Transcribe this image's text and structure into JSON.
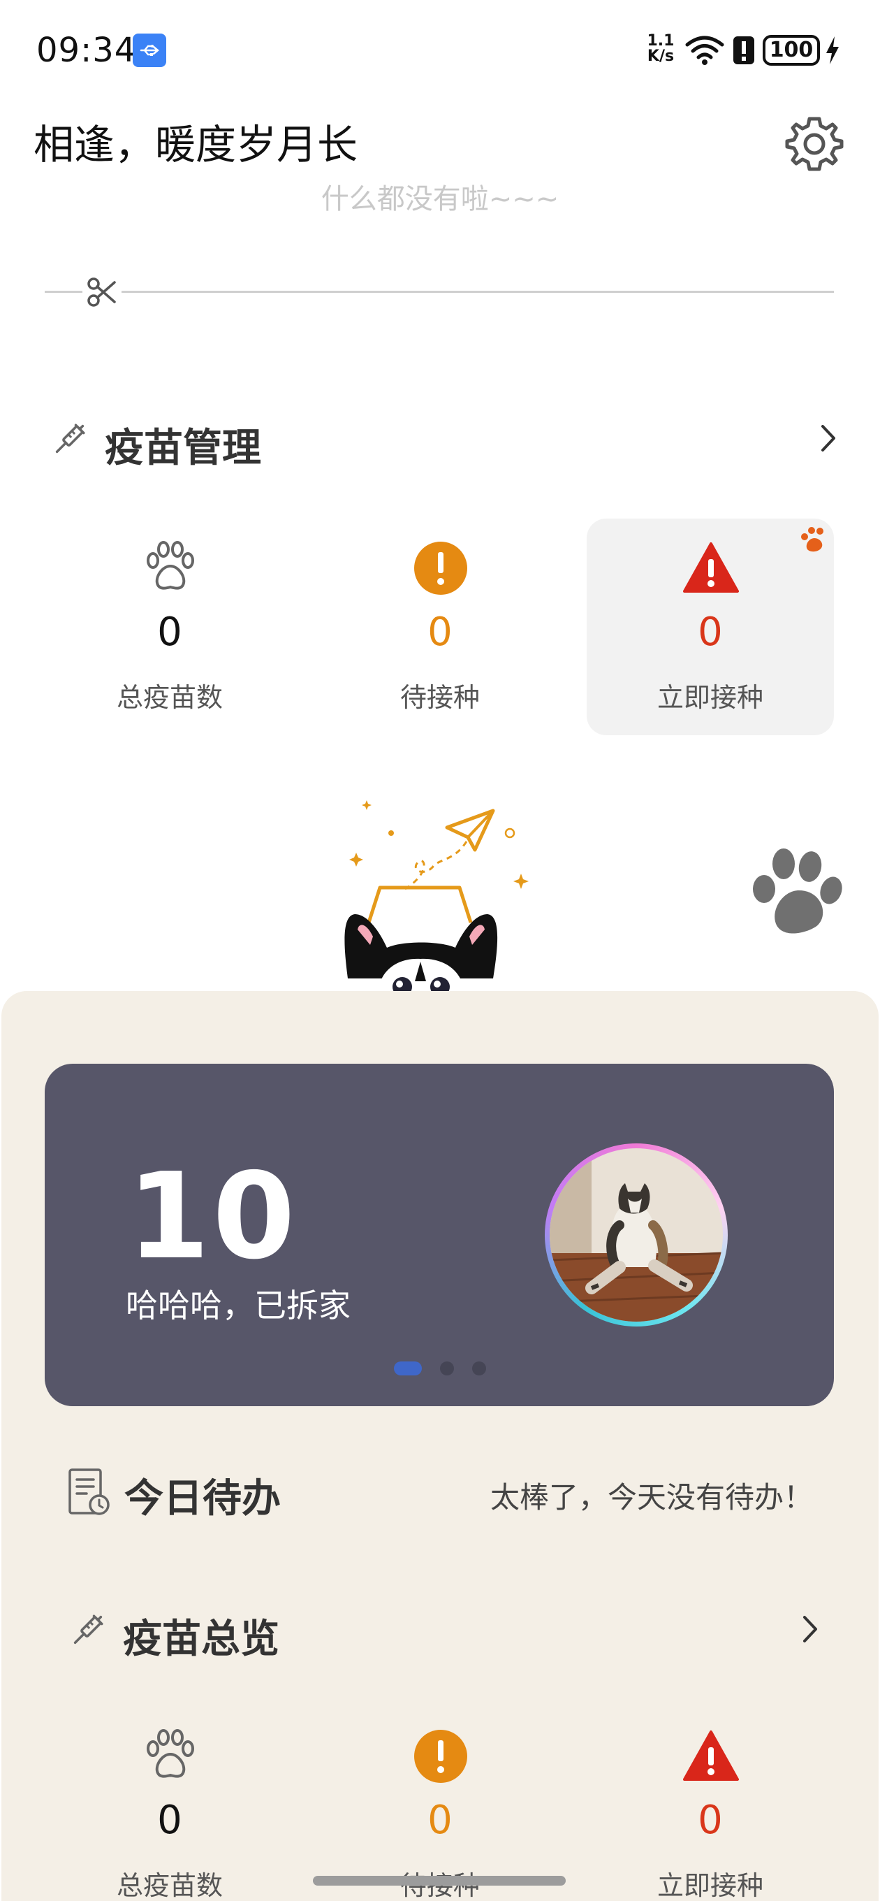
{
  "status_bar": {
    "time": "09:34",
    "net_speed_value": "1.1",
    "net_speed_unit": "K/s",
    "battery": "100",
    "icons": [
      "usb-icon",
      "wifi-icon",
      "alert-icon",
      "battery-icon",
      "charging-icon"
    ]
  },
  "header": {
    "title": "相逢，暖度岁月长",
    "settings_icon": "gear-icon"
  },
  "empty_text": "什么都没有啦~~~",
  "vaccine_management": {
    "title": "疫苗管理",
    "stats": [
      {
        "value": "0",
        "label": "总疫苗数",
        "icon": "paw-icon"
      },
      {
        "value": "0",
        "label": "待接种",
        "icon": "exclamation-circle-icon"
      },
      {
        "value": "0",
        "label": "立即接种",
        "icon": "warning-triangle-icon"
      }
    ]
  },
  "banner": {
    "number": "10",
    "text": "哈哈哈，已拆家",
    "active_page": 1,
    "page_count": 3
  },
  "todo": {
    "title": "今日待办",
    "status": "太棒了，今天没有待办！"
  },
  "vaccine_overview": {
    "title": "疫苗总览",
    "stats": [
      {
        "value": "0",
        "label": "总疫苗数",
        "icon": "paw-icon"
      },
      {
        "value": "0",
        "label": "待接种",
        "icon": "exclamation-circle-icon"
      },
      {
        "value": "0",
        "label": "立即接种",
        "icon": "warning-triangle-icon"
      }
    ]
  },
  "colors": {
    "accent_orange": "#e58a12",
    "alert_red": "#d9361a",
    "banner_bg": "#575669",
    "sheet_bg": "#f4efe6",
    "dot_active": "#3f67c9"
  }
}
